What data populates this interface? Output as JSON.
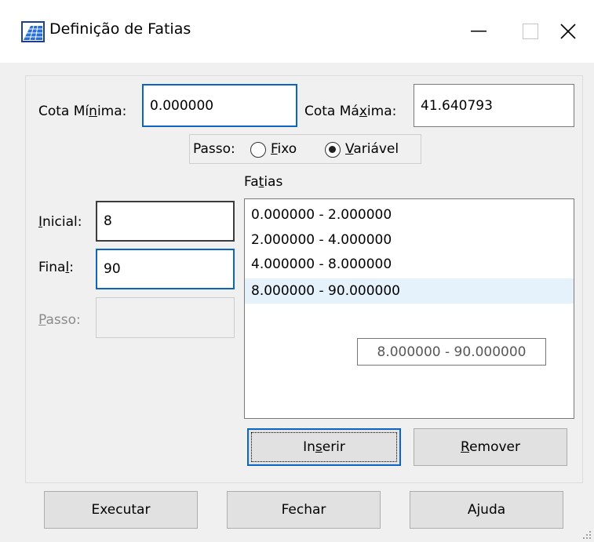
{
  "window": {
    "title": "Definição de Fatias",
    "icon": "grid-slices-icon"
  },
  "cota_minima": {
    "label": "Cota Mínima:",
    "value": "0.000000"
  },
  "cota_maxima": {
    "label": "Cota Máxima:",
    "value": "41.640793"
  },
  "passo_mode": {
    "label": "Passo:",
    "options": [
      "Fixo",
      "Variável"
    ],
    "selected": "Variável"
  },
  "fatias": {
    "label": "Fatias",
    "items": [
      "0.000000 - 2.000000",
      "2.000000 - 4.000000",
      "4.000000 - 8.000000",
      "8.000000 - 90.000000"
    ],
    "selected_index": 3,
    "tooltip": "8.000000 - 90.000000"
  },
  "inicial": {
    "label": "Inicial:",
    "value": "8"
  },
  "final": {
    "label": "Final:",
    "value": "90"
  },
  "passo_step": {
    "label": "Passo:",
    "value": ""
  },
  "buttons": {
    "inserir": "Inserir",
    "remover": "Remover",
    "executar": "Executar",
    "fechar": "Fechar",
    "ajuda": "Ajuda"
  }
}
